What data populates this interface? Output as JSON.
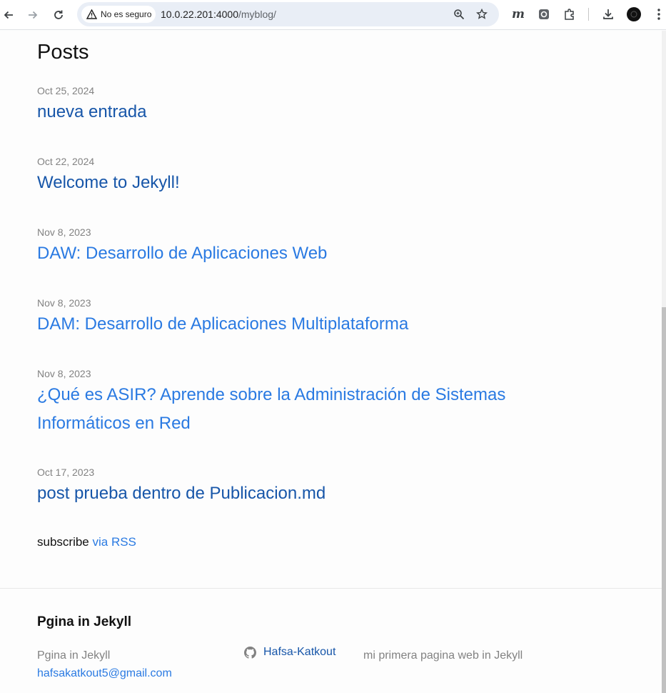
{
  "browser": {
    "security_label": "No es seguro",
    "url_host": "10.0.22.201:4000",
    "url_path": "/myblog/",
    "icons": [
      "back-icon",
      "forward-icon",
      "reload-icon",
      "warning-icon",
      "zoom-icon",
      "bookmark-star-icon",
      "extension-m-icon",
      "extension-camera-icon",
      "extensions-puzzle-icon",
      "download-icon",
      "profile-avatar",
      "menu-kebab-icon"
    ]
  },
  "main": {
    "heading": "Posts",
    "posts": [
      {
        "date": "Oct 25, 2024",
        "title": "nueva entrada"
      },
      {
        "date": "Oct 22, 2024",
        "title": "Welcome to Jekyll!"
      },
      {
        "date": "Nov 8, 2023",
        "title": "DAW: Desarrollo de Aplicaciones Web"
      },
      {
        "date": "Nov 8, 2023",
        "title": "DAM: Desarrollo de Aplicaciones Multiplataforma"
      },
      {
        "date": "Nov 8, 2023",
        "title_line1": "¿Qué es ASIR? Aprende sobre la Administración de Sistemas",
        "title_line2": "Informáticos en Red"
      },
      {
        "date": "Oct 17, 2023",
        "title": "post prueba dentro de Publicacion.md"
      }
    ],
    "subscribe_text": "subscribe ",
    "subscribe_link": "via RSS"
  },
  "footer": {
    "heading": "Pgina in Jekyll",
    "site_name": "Pgina in Jekyll",
    "email": "hafsakatkout5@gmail.com",
    "github_user": "Hafsa-Katkout",
    "description": "mi primera pagina web in Jekyll"
  },
  "colors": {
    "link": "#2a7ae2",
    "visited_link": "#1756a9",
    "muted_text": "#828282",
    "text": "#111111"
  }
}
